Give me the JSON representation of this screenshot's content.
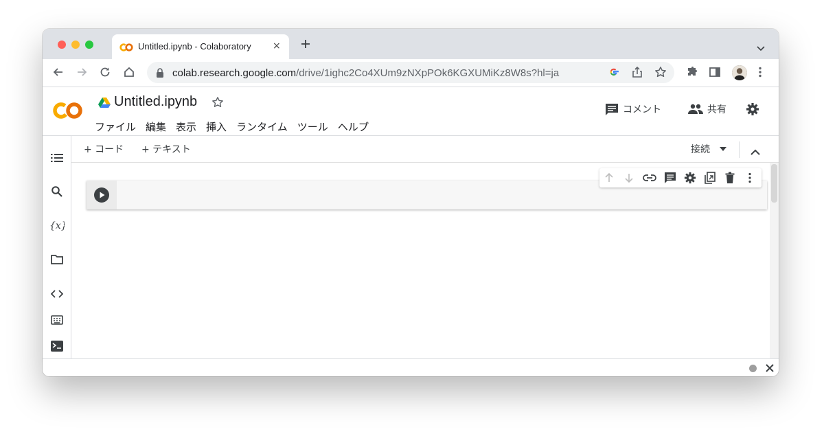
{
  "browser": {
    "tab": {
      "title": "Untitled.ipynb - Colaboratory",
      "close_icon": "×",
      "favicon": "colab-logo-icon"
    },
    "new_tab_icon": "+",
    "address": {
      "domain": "colab.research.google.com",
      "path": "/drive/1ighc2Co4XUm9zNXpPOk6KGXUMiKz8W8s?hl=ja"
    },
    "toolbar_icons": [
      "back-icon",
      "forward-icon",
      "reload-icon",
      "home-icon",
      "lock-icon",
      "google-icon",
      "share-icon",
      "bookmark-star-icon",
      "extensions-icon",
      "side-panel-icon",
      "profile-avatar",
      "more-vert-icon"
    ],
    "traffic_lights": {
      "close": "#ff5f57",
      "minimize": "#febc2e",
      "maximize": "#28c840"
    }
  },
  "colab": {
    "logo_text": "CO",
    "notebook_title": "Untitled.ipynb",
    "menus": [
      "ファイル",
      "編集",
      "表示",
      "挿入",
      "ランタイム",
      "ツール",
      "ヘルプ"
    ],
    "comment_label": "コメント",
    "share_label": "共有",
    "add_code_label": "+ コード",
    "add_text_label": "+ テキスト",
    "connect_label": "接続",
    "status_dot_color": "#9e9e9e",
    "status_close_icon": "×",
    "colors": {
      "logo_orange": "#f9ab00",
      "logo_dark_orange": "#e8710a",
      "drive_blue": "#4285f4",
      "drive_green": "#0f9d58",
      "drive_yellow": "#f4b400"
    }
  }
}
